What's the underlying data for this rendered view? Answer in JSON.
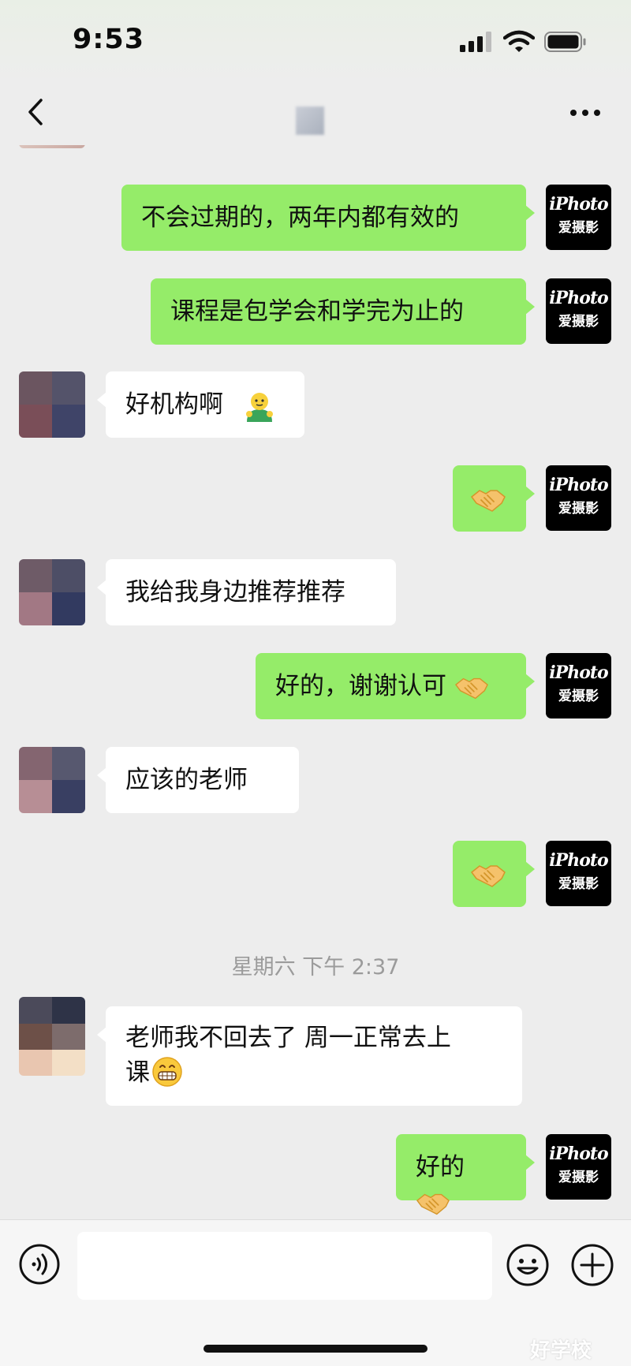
{
  "status_bar": {
    "time": "9:53"
  },
  "nav": {
    "back_icon": "chevron-left-icon",
    "more_icon": "more-dots-icon"
  },
  "my_avatar": {
    "logo_text": "iPhoto",
    "logo_subtext": "爱摄影"
  },
  "messages": [
    {
      "from": "me",
      "text": "不会过期的，两年内都有效的"
    },
    {
      "from": "me",
      "text": "课程是包学会和学完为止的"
    },
    {
      "from": "them",
      "text": "好机构啊",
      "emoji": "emoji-icon"
    },
    {
      "from": "me",
      "text": "",
      "emoji": "handshake-icon"
    },
    {
      "from": "them",
      "text": "我给我身边推荐推荐"
    },
    {
      "from": "me",
      "text": "好的，谢谢认可",
      "emoji": "handshake-icon"
    },
    {
      "from": "them",
      "text": "应该的老师"
    },
    {
      "from": "me",
      "text": "",
      "emoji": "handshake-icon"
    },
    {
      "from": "them",
      "text_line1": "老师我不回去了  周一正常去上",
      "text_line2": "课",
      "emoji": "grin-icon"
    },
    {
      "from": "me",
      "text": "好的",
      "emoji": "handshake-icon"
    }
  ],
  "time_separator": "星期六 下午 2:37",
  "input": {
    "value": "",
    "voice_icon": "voice-icon",
    "emoji_icon": "smile-icon",
    "plus_icon": "plus-icon"
  },
  "watermark": "好学校",
  "colors": {
    "me_bubble": "#95ec69",
    "them_bubble": "#ffffff",
    "background": "#ededed"
  }
}
